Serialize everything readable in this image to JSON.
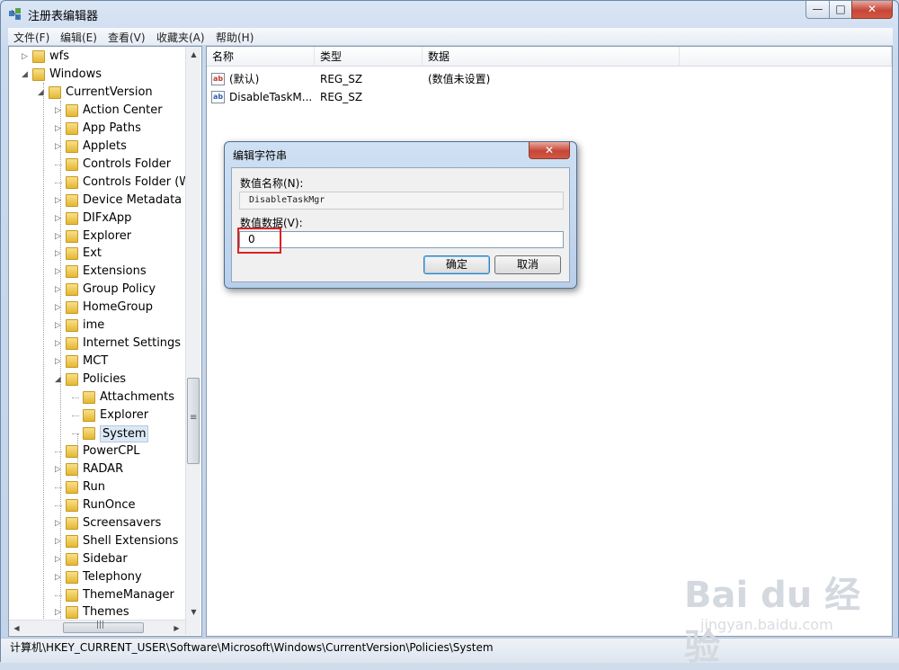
{
  "window": {
    "title": "注册表编辑器"
  },
  "window_buttons": {
    "minimize": "—",
    "maximize": "□",
    "close": "✕"
  },
  "menu": [
    "文件(F)",
    "编辑(E)",
    "查看(V)",
    "收藏夹(A)",
    "帮助(H)"
  ],
  "tree": {
    "items": [
      {
        "label": "wfs",
        "level": 0,
        "expander": "▷"
      },
      {
        "label": "Windows",
        "level": 0,
        "expander": "◢"
      },
      {
        "label": "CurrentVersion",
        "level": 1,
        "expander": "◢"
      },
      {
        "label": "Action Center",
        "level": 2,
        "expander": "▷"
      },
      {
        "label": "App Paths",
        "level": 2,
        "expander": "▷"
      },
      {
        "label": "Applets",
        "level": 2,
        "expander": "▷"
      },
      {
        "label": "Controls Folder",
        "level": 2,
        "expander": ""
      },
      {
        "label": "Controls Folder (W",
        "level": 2,
        "expander": ""
      },
      {
        "label": "Device Metadata",
        "level": 2,
        "expander": "▷"
      },
      {
        "label": "DIFxApp",
        "level": 2,
        "expander": "▷"
      },
      {
        "label": "Explorer",
        "level": 2,
        "expander": "▷"
      },
      {
        "label": "Ext",
        "level": 2,
        "expander": "▷"
      },
      {
        "label": "Extensions",
        "level": 2,
        "expander": "▷"
      },
      {
        "label": "Group Policy",
        "level": 2,
        "expander": "▷"
      },
      {
        "label": "HomeGroup",
        "level": 2,
        "expander": "▷"
      },
      {
        "label": "ime",
        "level": 2,
        "expander": "▷"
      },
      {
        "label": "Internet Settings",
        "level": 2,
        "expander": "▷"
      },
      {
        "label": "MCT",
        "level": 2,
        "expander": "▷"
      },
      {
        "label": "Policies",
        "level": 2,
        "expander": "◢"
      },
      {
        "label": "Attachments",
        "level": 3,
        "expander": ""
      },
      {
        "label": "Explorer",
        "level": 3,
        "expander": ""
      },
      {
        "label": "System",
        "level": 3,
        "expander": "",
        "selected": true
      },
      {
        "label": "PowerCPL",
        "level": 2,
        "expander": ""
      },
      {
        "label": "RADAR",
        "level": 2,
        "expander": "▷"
      },
      {
        "label": "Run",
        "level": 2,
        "expander": ""
      },
      {
        "label": "RunOnce",
        "level": 2,
        "expander": ""
      },
      {
        "label": "Screensavers",
        "level": 2,
        "expander": "▷"
      },
      {
        "label": "Shell Extensions",
        "level": 2,
        "expander": "▷"
      },
      {
        "label": "Sidebar",
        "level": 2,
        "expander": "▷"
      },
      {
        "label": "Telephony",
        "level": 2,
        "expander": "▷"
      },
      {
        "label": "ThemeManager",
        "level": 2,
        "expander": ""
      },
      {
        "label": "Themes",
        "level": 2,
        "expander": "▷"
      }
    ]
  },
  "scrollbar": {
    "up": "▲",
    "down": "▼",
    "left": "◀",
    "right": "▶",
    "grip": "≡",
    "hgrip": "|||"
  },
  "list": {
    "columns": [
      "名称",
      "类型",
      "数据"
    ],
    "rows": [
      {
        "name": "(默认)",
        "type": "REG_SZ",
        "data": "(数值未设置)",
        "icon": "ab"
      },
      {
        "name": "DisableTaskM...",
        "type": "REG_SZ",
        "data": "",
        "icon": "ab"
      }
    ]
  },
  "dialog": {
    "title": "编辑字符串",
    "close": "✕",
    "name_label": "数值名称(N):",
    "name_value": "DisableTaskMgr",
    "data_label": "数值数据(V):",
    "data_value": "0",
    "ok": "确定",
    "cancel": "取消"
  },
  "statusbar": {
    "path": "计算机\\HKEY_CURRENT_USER\\Software\\Microsoft\\Windows\\CurrentVersion\\Policies\\System"
  },
  "watermark": {
    "brand": "Bai du 经验",
    "url": "jingyan.baidu.com"
  }
}
